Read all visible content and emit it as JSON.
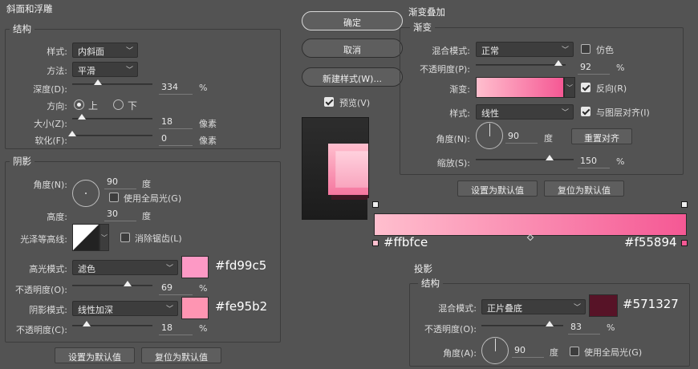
{
  "bevel": {
    "title": "斜面和浮雕",
    "structure_title": "结构",
    "style_label": "样式:",
    "style_value": "内斜面",
    "method_label": "方法:",
    "method_value": "平滑",
    "depth_label": "深度(D):",
    "depth_value": "334",
    "depth_unit": "%",
    "depth_fraction": 0.32,
    "direction_label": "方向:",
    "dir_up": "上",
    "dir_down": "下",
    "size_label": "大小(Z):",
    "size_value": "18",
    "size_unit": "像素",
    "size_fraction": 0.12,
    "soften_label": "软化(F):",
    "soften_value": "0",
    "soften_unit": "像素",
    "soften_fraction": 0.0
  },
  "shading": {
    "title": "阴影",
    "angle_label": "角度(N):",
    "angle_value": "90",
    "angle_unit": "度",
    "global_light_label": "使用全局光(G)",
    "altitude_label": "高度:",
    "altitude_value": "30",
    "altitude_unit": "度",
    "gloss_label": "光泽等高线:",
    "antialias_label": "消除锯齿(L)",
    "highlight_label": "高光模式:",
    "highlight_value": "滤色",
    "highlight_color": "#fd99c5",
    "highlight_hex": "#fd99c5",
    "hl_opacity_label": "不透明度(O):",
    "hl_opacity_value": "69",
    "hl_opacity_unit": "%",
    "hl_opacity_fraction": 0.69,
    "shadow_mode_label": "阴影模式:",
    "shadow_mode_value": "线性加深",
    "shadow_color": "#fe95b2",
    "shadow_hex": "#fe95b2",
    "sh_opacity_label": "不透明度(C):",
    "sh_opacity_value": "18",
    "sh_opacity_unit": "%",
    "sh_opacity_fraction": 0.18,
    "set_default": "设置为默认值",
    "reset_default": "复位为默认值"
  },
  "actions": {
    "ok": "确定",
    "cancel": "取消",
    "new_style": "新建样式(W)...",
    "preview": "预览(V)"
  },
  "gradient_overlay": {
    "title": "渐变叠加",
    "sub_title": "渐变",
    "blend_label": "混合模式:",
    "blend_value": "正常",
    "dither_label": "仿色",
    "opacity_label": "不透明度(P):",
    "opacity_value": "92",
    "opacity_unit": "%",
    "opacity_fraction": 0.92,
    "gradient_label": "渐变:",
    "reverse_label": "反向(R)",
    "style_label": "样式:",
    "style_value": "线性",
    "align_label": "与图层对齐(I)",
    "angle_label": "角度(N):",
    "angle_value": "90",
    "angle_unit": "度",
    "reset_align": "重置对齐",
    "scale_label": "缩放(S):",
    "scale_value": "150",
    "scale_unit": "%",
    "scale_fraction": 0.75,
    "set_default": "设置为默认值",
    "reset_default": "复位为默认值"
  },
  "gradient_bar": {
    "start_color": "#ffbfce",
    "end_color": "#f55894",
    "start_hex": "#ffbfce",
    "end_hex": "#f55894"
  },
  "drop_shadow": {
    "title": "投影",
    "structure_title": "结构",
    "blend_label": "混合模式:",
    "blend_value": "正片叠底",
    "color": "#571327",
    "hex": "#571327",
    "opacity_label": "不透明度(O):",
    "opacity_value": "83",
    "opacity_unit": "%",
    "opacity_fraction": 0.83,
    "angle_label": "角度(A):",
    "angle_value": "90",
    "angle_unit": "度",
    "global_light_label": "使用全局光(G)"
  }
}
